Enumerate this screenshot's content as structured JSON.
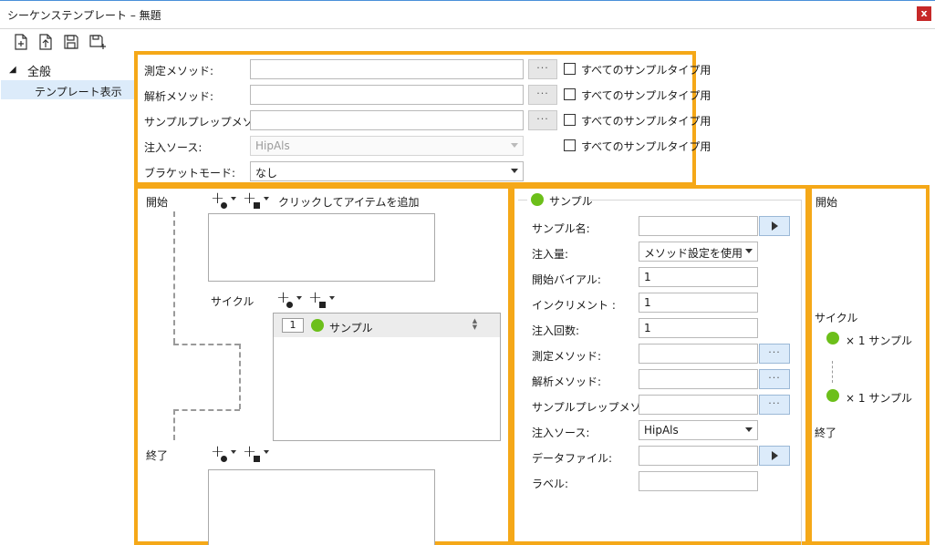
{
  "window": {
    "title": "シーケンステンプレート – 無題",
    "close": "x"
  },
  "toolbar": {
    "icons": [
      "new-file-icon",
      "open-file-icon",
      "save-icon",
      "save-as-icon"
    ]
  },
  "tree": {
    "root_label": "全般",
    "selected_item": "テンプレート表示"
  },
  "method_panel": {
    "measure_label": "測定メソッド:",
    "analysis_label": "解析メソッド:",
    "sampleprep_label": "サンプルプレップメソッド:",
    "injection_label": "注入ソース:",
    "injection_value": "HipAls",
    "bracket_label": "ブラケットモード:",
    "bracket_value": "なし",
    "all_sample_types": "すべてのサンプルタイプ用",
    "dots": "···"
  },
  "sequence_panel": {
    "start_label": "開始",
    "add_item_hint": "クリックしてアイテムを追加",
    "cycle_label": "サイクル",
    "end_label": "終了",
    "cycle_item": {
      "count": "1",
      "name": "サンプル"
    }
  },
  "sample_panel": {
    "header": "サンプル",
    "fields": {
      "sample_name_label": "サンプル名:",
      "injection_volume_label": "注入量:",
      "injection_volume_value": "メソッド設定を使用",
      "start_vial_label": "開始バイアル:",
      "start_vial_value": "1",
      "increment_label": "インクリメント :",
      "increment_value": "1",
      "injection_count_label": "注入回数:",
      "injection_count_value": "1",
      "measure_label": "測定メソッド:",
      "analysis_label": "解析メソッド:",
      "sampleprep_label": "サンプルプレップメソッド:",
      "injection_source_label": "注入ソース:",
      "injection_source_value": "HipAls",
      "datafile_label": "データファイル:",
      "label_label": "ラベル:"
    }
  },
  "summary_panel": {
    "start_label": "開始",
    "cycle_label": "サイクル",
    "item1": "× 1  サンプル",
    "item2": "× 1  サンプル",
    "end_label": "終了"
  },
  "colors": {
    "accent_orange": "#f5a818",
    "sample_green": "#6cbf1a",
    "selection_blue": "#dcebfa"
  }
}
